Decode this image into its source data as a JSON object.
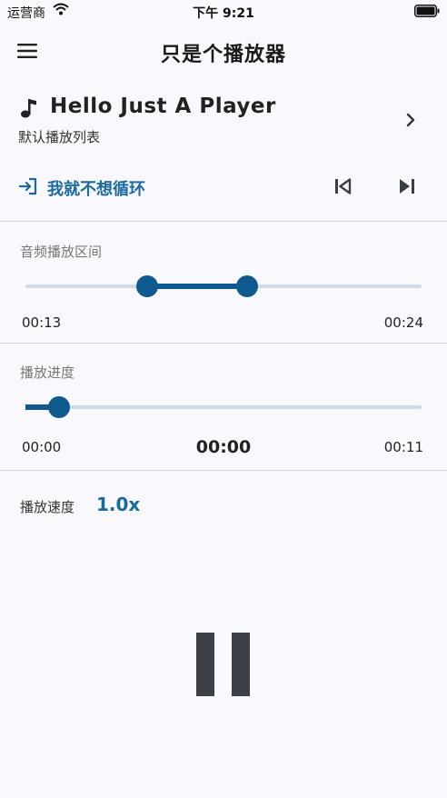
{
  "status_bar": {
    "carrier": "运营商",
    "time": "下午 9:21"
  },
  "header": {
    "title": "只是个播放器"
  },
  "track": {
    "title": "Hello Just A Player",
    "playlist": "默认播放列表"
  },
  "loop": {
    "label": "我就不想循环"
  },
  "range": {
    "label": "音频播放区间",
    "start_time": "00:13",
    "end_time": "00:24",
    "start_fraction": 0.307,
    "end_fraction": 0.56
  },
  "progress": {
    "label": "播放进度",
    "elapsed": "00:00",
    "current": "00:00",
    "total": "00:11",
    "fraction": 0.085
  },
  "speed": {
    "label": "播放速度",
    "value": "1.0x"
  },
  "colors": {
    "accent": "#0e5a8f",
    "accent_text": "#1b6a9e",
    "track": "#cfdce8",
    "background": "#f9f9fd"
  },
  "icons": {
    "menu": "menu-icon",
    "note": "music-note-icon",
    "chevron": "chevron-right-icon",
    "loop": "login-arrow-icon",
    "prev": "skip-previous-icon",
    "next": "skip-next-icon",
    "pause": "pause-icon"
  }
}
